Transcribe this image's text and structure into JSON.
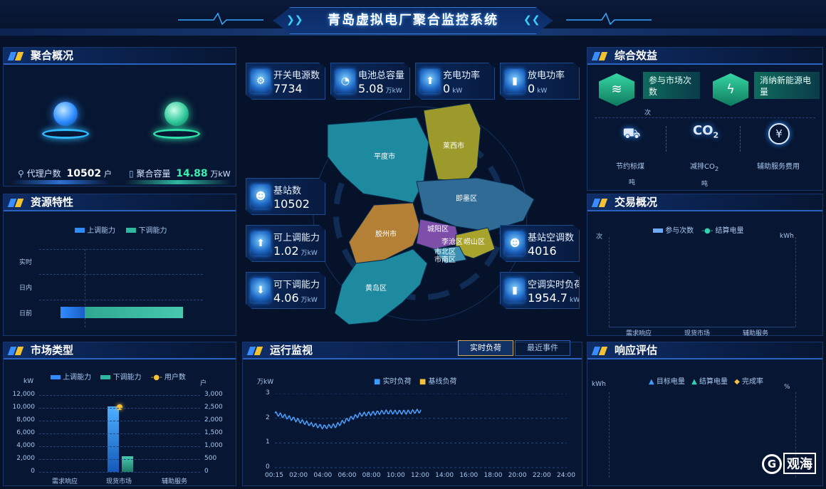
{
  "header": {
    "title": "青岛虚拟电厂聚合监控系统"
  },
  "aggregate": {
    "title": "聚合概况",
    "agent_label": "代理户数",
    "agent_value": "10502",
    "agent_unit": "户",
    "capacity_label": "聚合容量",
    "capacity_value": "14.88",
    "capacity_unit": "万kW"
  },
  "resource": {
    "title": "资源特性",
    "legend_up": "上调能力",
    "legend_down": "下调能力",
    "rows": [
      "实时",
      "日内",
      "日前"
    ],
    "chart_data": {
      "type": "bar",
      "categories": [
        "实时",
        "日内",
        "日前"
      ],
      "series": [
        {
          "name": "上调能力",
          "values": [
            0,
            0,
            1.02
          ]
        },
        {
          "name": "下调能力",
          "values": [
            0,
            0,
            4.06
          ]
        }
      ],
      "orientation": "horizontal"
    }
  },
  "market": {
    "title": "市场类型",
    "legend": [
      "上调能力",
      "下调能力",
      "用户数"
    ],
    "left_unit": "kW",
    "right_unit": "户",
    "left_ticks": [
      "12,000",
      "10,000",
      "8,000",
      "6,000",
      "4,000",
      "2,000",
      "0"
    ],
    "right_ticks": [
      "3,000",
      "2,500",
      "2,000",
      "1,500",
      "1,000",
      "500",
      "0"
    ],
    "categories": [
      "需求响应",
      "现货市场",
      "辅助服务"
    ],
    "chart_data": {
      "type": "bar",
      "categories": [
        "需求响应",
        "现货市场",
        "辅助服务"
      ],
      "series": [
        {
          "name": "上调能力",
          "values": [
            0,
            10200,
            0
          ]
        },
        {
          "name": "下调能力",
          "values": [
            0,
            2400,
            0
          ]
        },
        {
          "name": "用户数",
          "values": [
            0,
            2540,
            0
          ]
        }
      ],
      "ylim": [
        0,
        12000
      ],
      "y2lim": [
        0,
        3000
      ]
    }
  },
  "stats": {
    "switch": {
      "label": "开关电源数",
      "value": "7734",
      "unit": ""
    },
    "battery": {
      "label": "电池总容量",
      "value": "5.08",
      "unit": "万kW"
    },
    "charge": {
      "label": "充电功率",
      "value": "0",
      "unit": "kW"
    },
    "discharge": {
      "label": "放电功率",
      "value": "0",
      "unit": "kW"
    },
    "base": {
      "label": "基站数",
      "value": "10502",
      "unit": ""
    },
    "up": {
      "label": "可上调能力",
      "value": "1.02",
      "unit": "万kW"
    },
    "down": {
      "label": "可下调能力",
      "value": "4.06",
      "unit": "万kW"
    },
    "ac": {
      "label": "基站空调数",
      "value": "4016",
      "unit": ""
    },
    "acload": {
      "label": "空调实时负荷",
      "value": "1954.7",
      "unit": "kW"
    }
  },
  "map": {
    "regions": [
      "平度市",
      "莱西市",
      "即墨区",
      "胶州市",
      "城阳区",
      "李沧区",
      "崂山区",
      "市北区",
      "市南区",
      "黄岛区"
    ]
  },
  "monitor": {
    "title": "运行监视",
    "tab_realtime": "实时负荷",
    "tab_events": "最近事件",
    "legend_actual": "实时负荷",
    "legend_base": "基线负荷",
    "yunit": "万kW",
    "yticks": [
      "3",
      "2",
      "1",
      "0"
    ],
    "xticks": [
      "00:15",
      "02:00",
      "04:00",
      "06:00",
      "08:00",
      "10:00",
      "12:00",
      "14:00",
      "16:00",
      "18:00",
      "20:00",
      "22:00",
      "24:00"
    ],
    "chart_data": {
      "type": "line",
      "ylim": [
        0,
        3
      ],
      "series": [
        {
          "name": "实时负荷",
          "x": [
            "00:15",
            "01:00",
            "02:00",
            "03:00",
            "04:00",
            "05:00",
            "06:00",
            "07:00",
            "08:00",
            "09:00",
            "10:00",
            "11:00",
            "12:00"
          ],
          "values": [
            2.2,
            2.05,
            1.9,
            1.75,
            1.65,
            1.7,
            1.95,
            2.15,
            2.2,
            2.25,
            2.25,
            2.25,
            2.3
          ]
        }
      ]
    }
  },
  "benefit": {
    "title": "综合效益",
    "market_label": "参与市场次数",
    "market_unit": "次",
    "clean_label": "消纳新能源电量",
    "coal_label": "节约标煤",
    "coal_unit": "吨",
    "co2_label": "减排CO",
    "co2_sub": "2",
    "co2_unit": "吨",
    "aux_label": "辅助服务费用",
    "co2_icon": "CO"
  },
  "trade": {
    "title": "交易概况",
    "legend_count": "参与次数",
    "legend_energy": "结算电量",
    "left_unit": "次",
    "right_unit": "kWh",
    "categories": [
      "需求响应",
      "现货市场",
      "辅助服务"
    ]
  },
  "response": {
    "title": "响应评估",
    "legend": [
      "目标电量",
      "结算电量",
      "完成率"
    ],
    "left_unit": "kWh",
    "right_unit": "%"
  },
  "watermark": {
    "text": "观海"
  }
}
